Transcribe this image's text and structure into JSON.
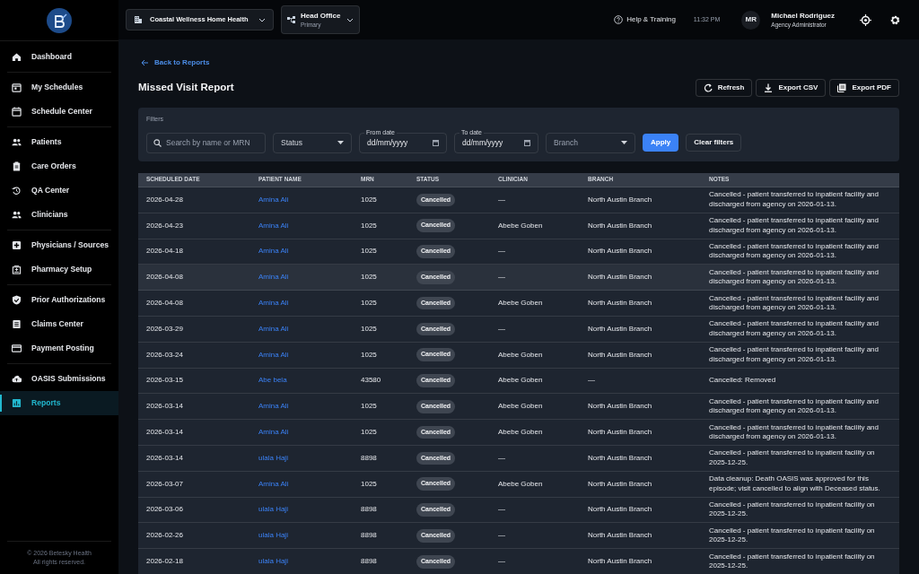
{
  "sidebar": {
    "groups": [
      [
        {
          "label": "Dashboard",
          "selected": false
        }
      ],
      [
        {
          "label": "My Schedules",
          "selected": false
        },
        {
          "label": "Schedule Center",
          "selected": false
        }
      ],
      [
        {
          "label": "Patients",
          "selected": false
        },
        {
          "label": "Care Orders",
          "selected": false
        },
        {
          "label": "QA Center",
          "selected": false
        },
        {
          "label": "Clinicians",
          "selected": false
        }
      ],
      [
        {
          "label": "Physicians / Sources",
          "selected": false
        },
        {
          "label": "Pharmacy Setup",
          "selected": false
        }
      ],
      [
        {
          "label": "Prior Authorizations",
          "selected": false
        },
        {
          "label": "Claims Center",
          "selected": false
        },
        {
          "label": "Payment Posting",
          "selected": false
        }
      ],
      [
        {
          "label": "OASIS Submissions",
          "selected": false
        },
        {
          "label": "Reports",
          "selected": true
        }
      ]
    ],
    "footer": [
      "© 2026 Betesky Health",
      "All rights reserved."
    ]
  },
  "topbar": {
    "organization": "Coastal Wellness Home Health",
    "office": {
      "name": "Head Office",
      "subtitle": "Primary"
    },
    "help": "Help & Training",
    "time": "11:32 PM",
    "user": {
      "initials": "MR",
      "name": "Michael Rodriguez",
      "role": "Agency Administrator"
    }
  },
  "page": {
    "back_link": "Back to Reports",
    "title": "Missed Visit Report",
    "actions": [
      "Refresh",
      "Export CSV",
      "Export PDF"
    ]
  },
  "filters": {
    "label": "Filters",
    "search": {
      "placeholder": "Search by name or MRN"
    },
    "status": {
      "placeholder": "Status"
    },
    "from_date": {
      "label": "From date",
      "value": "dd/mm/yyyy"
    },
    "to_date": {
      "label": "To date",
      "value": "dd/mm/yyyy"
    },
    "branch": {
      "placeholder": "Branch"
    },
    "apply": "Apply",
    "clear": "Clear filters"
  },
  "table": {
    "columns": [
      "SCHEDULED DATE",
      "PATIENT NAME",
      "MRN",
      "STATUS",
      "CLINICIAN",
      "BRANCH",
      "NOTES"
    ],
    "rows": [
      {
        "date": "2026-04-28",
        "patient": "Amina Ali",
        "mrn": "1025",
        "status": "Cancelled",
        "clinician": "—",
        "branch": "North Austin Branch",
        "notes": "Cancelled - patient transferred to inpatient facility and discharged from agency on 2026-01-13.",
        "highlighted": false
      },
      {
        "date": "2026-04-23",
        "patient": "Amina Ali",
        "mrn": "1025",
        "status": "Cancelled",
        "clinician": "Abebe Goben",
        "branch": "North Austin Branch",
        "notes": "Cancelled - patient transferred to inpatient facility and discharged from agency on 2026-01-13.",
        "highlighted": false
      },
      {
        "date": "2026-04-18",
        "patient": "Amina Ali",
        "mrn": "1025",
        "status": "Cancelled",
        "clinician": "—",
        "branch": "North Austin Branch",
        "notes": "Cancelled - patient transferred to inpatient facility and discharged from agency on 2026-01-13.",
        "highlighted": false
      },
      {
        "date": "2026-04-08",
        "patient": "Amina Ali",
        "mrn": "1025",
        "status": "Cancelled",
        "clinician": "—",
        "branch": "North Austin Branch",
        "notes": "Cancelled - patient transferred to inpatient facility and discharged from agency on 2026-01-13.",
        "highlighted": true
      },
      {
        "date": "2026-04-08",
        "patient": "Amina Ali",
        "mrn": "1025",
        "status": "Cancelled",
        "clinician": "Abebe Goben",
        "branch": "North Austin Branch",
        "notes": "Cancelled - patient transferred to inpatient facility and discharged from agency on 2026-01-13.",
        "highlighted": false
      },
      {
        "date": "2026-03-29",
        "patient": "Amina Ali",
        "mrn": "1025",
        "status": "Cancelled",
        "clinician": "—",
        "branch": "North Austin Branch",
        "notes": "Cancelled - patient transferred to inpatient facility and discharged from agency on 2026-01-13.",
        "highlighted": false
      },
      {
        "date": "2026-03-24",
        "patient": "Amina Ali",
        "mrn": "1025",
        "status": "Cancelled",
        "clinician": "Abebe Goben",
        "branch": "North Austin Branch",
        "notes": "Cancelled - patient transferred to inpatient facility and discharged from agency on 2026-01-13.",
        "highlighted": false
      },
      {
        "date": "2026-03-15",
        "patient": "Abe bela",
        "mrn": "43580",
        "status": "Cancelled",
        "clinician": "Abebe Goben",
        "branch": "—",
        "notes": "Cancelled: Removed",
        "highlighted": false
      },
      {
        "date": "2026-03-14",
        "patient": "Amina Ali",
        "mrn": "1025",
        "status": "Cancelled",
        "clinician": "Abebe Goben",
        "branch": "North Austin Branch",
        "notes": "Cancelled - patient transferred to inpatient facility and discharged from agency on 2026-01-13.",
        "highlighted": false
      },
      {
        "date": "2026-03-14",
        "patient": "Amina Ali",
        "mrn": "1025",
        "status": "Cancelled",
        "clinician": "Abebe Goben",
        "branch": "North Austin Branch",
        "notes": "Cancelled - patient transferred to inpatient facility and discharged from agency on 2026-01-13.",
        "highlighted": false
      },
      {
        "date": "2026-03-14",
        "patient": "ulala Haji",
        "mrn": "8898",
        "status": "Cancelled",
        "clinician": "—",
        "branch": "North Austin Branch",
        "notes": "Cancelled - patient transferred to inpatient facility on 2025-12-25.",
        "highlighted": false
      },
      {
        "date": "2026-03-07",
        "patient": "Amina Ali",
        "mrn": "1025",
        "status": "Cancelled",
        "clinician": "Abebe Goben",
        "branch": "North Austin Branch",
        "notes": "Data cleanup: Death OASIS was approved for this episode; visit cancelled to align with Deceased status.",
        "highlighted": false
      },
      {
        "date": "2026-03-06",
        "patient": "ulala Haji",
        "mrn": "8898",
        "status": "Cancelled",
        "clinician": "—",
        "branch": "North Austin Branch",
        "notes": "Cancelled - patient transferred to inpatient facility on 2025-12-25.",
        "highlighted": false
      },
      {
        "date": "2026-02-26",
        "patient": "ulala Haji",
        "mrn": "8898",
        "status": "Cancelled",
        "clinician": "—",
        "branch": "North Austin Branch",
        "notes": "Cancelled - patient transferred to inpatient facility on 2025-12-25.",
        "highlighted": false
      },
      {
        "date": "2026-02-18",
        "patient": "ulala Haji",
        "mrn": "8898",
        "status": "Cancelled",
        "clinician": "—",
        "branch": "North Austin Branch",
        "notes": "Cancelled - patient transferred to inpatient facility on 2025-12-25.",
        "highlighted": false
      }
    ]
  }
}
